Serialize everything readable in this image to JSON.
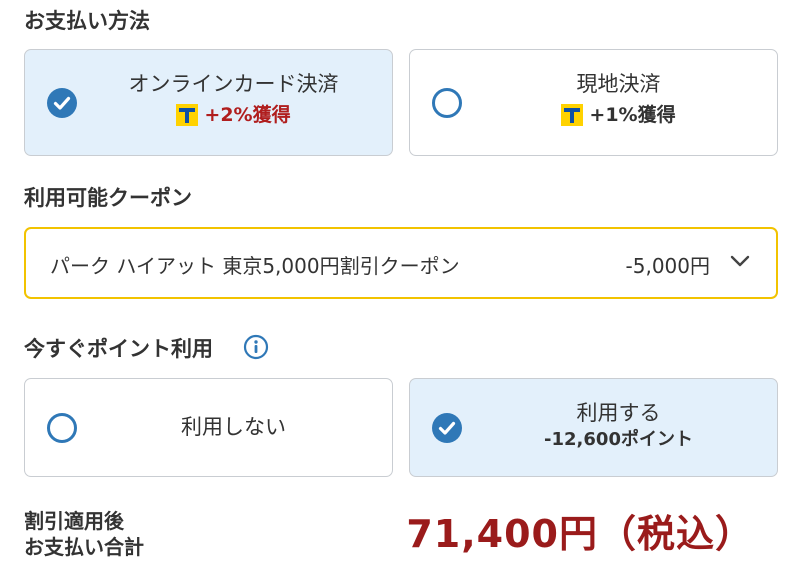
{
  "payment": {
    "title": "お支払い方法",
    "options": [
      {
        "label": "オンラインカード決済",
        "points": "+2%獲得",
        "selected": true,
        "points_color": "#b01e1e"
      },
      {
        "label": "現地決済",
        "points": "+1%獲得",
        "selected": false,
        "points_color": "#333333"
      }
    ]
  },
  "coupon": {
    "title": "利用可能クーポン",
    "name": "パーク ハイアット 東京5,000円割引クーポン",
    "amount": "-5,000円"
  },
  "points_use": {
    "title": "今すぐポイント利用",
    "options": [
      {
        "label": "利用しない",
        "detail": "",
        "selected": false
      },
      {
        "label": "利用する",
        "detail": "-12,600ポイント",
        "selected": true
      }
    ]
  },
  "total": {
    "label_line1": "割引適用後",
    "label_line2": "お支払い合計",
    "value": "71,400円（税込）"
  },
  "colors": {
    "accent": "#2f78b7",
    "selected_bg": "#e3f0fb",
    "coupon_border": "#f2c300",
    "total_red": "#9a1b1b",
    "tpoint_yellow": "#ffd200",
    "tpoint_blue": "#0f4fa3"
  },
  "icons": {
    "checked": "check-circle-icon",
    "unchecked": "radio-empty-icon",
    "tpoint": "t-point-icon",
    "info": "info-icon",
    "chevron": "chevron-down-icon"
  }
}
